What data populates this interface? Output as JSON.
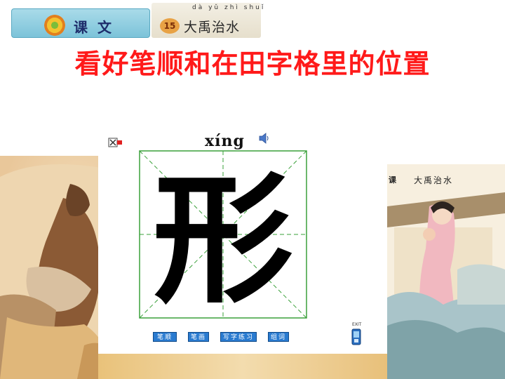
{
  "header": {
    "tab_kewen": "课文",
    "lesson_number": "15",
    "lesson_pinyin": "dà  yǔ  zhì  shuǐ",
    "lesson_name": "大禹治水"
  },
  "heading": "看好笔顺和在田字格里的位置",
  "panel": {
    "pinyin": "xíng",
    "character": "形",
    "buttons": [
      "笔顺",
      "笔画",
      "写字练习",
      "组词"
    ],
    "exit_label": "EXIT"
  },
  "right_illustration": {
    "caption_prefix": "课",
    "caption": "大禹治水"
  },
  "colors": {
    "heading": "#ff1a1a",
    "grid": "#3aa03a",
    "button": "#2a7bd0"
  }
}
